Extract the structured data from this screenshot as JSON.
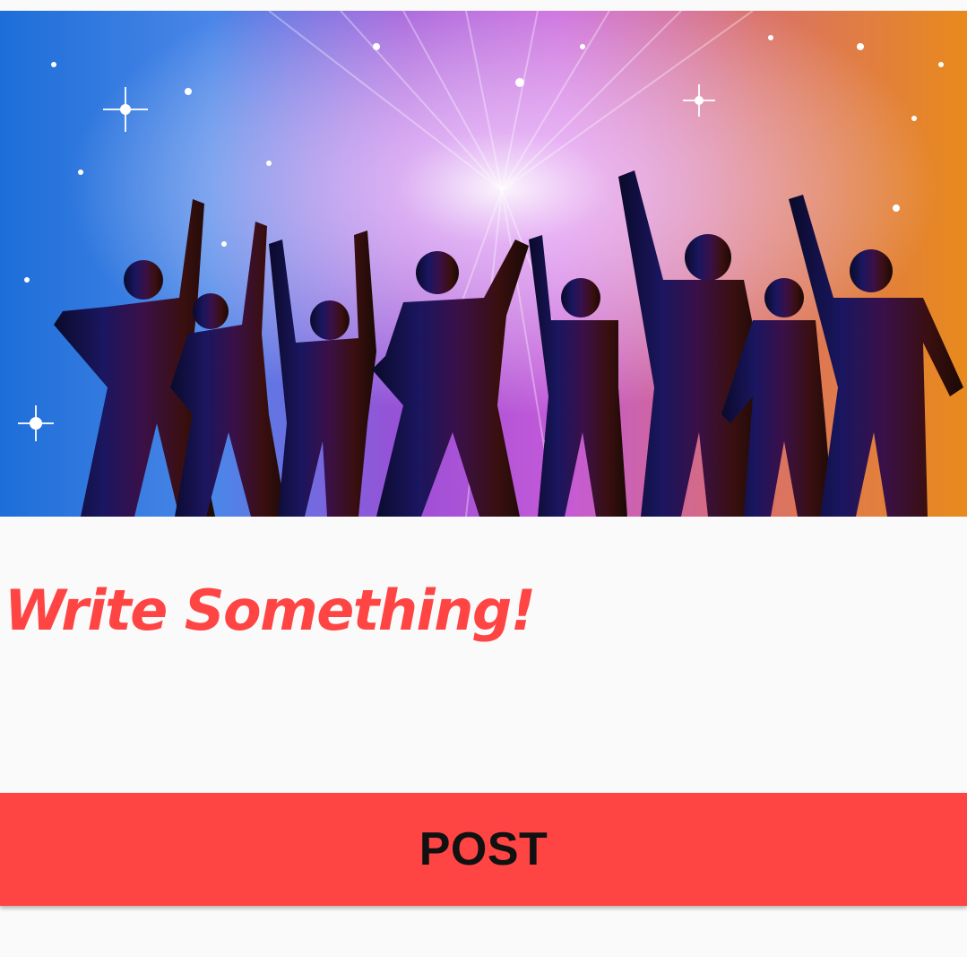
{
  "colors": {
    "background": "#fafafa",
    "accent": "#ff4444",
    "button_text": "#111111"
  },
  "hero_image": {
    "subject": "silhouettes of people dancing against colorful sparkling party lights"
  },
  "composer": {
    "placeholder": "Write Something!"
  },
  "post_button": {
    "label": "POST"
  }
}
